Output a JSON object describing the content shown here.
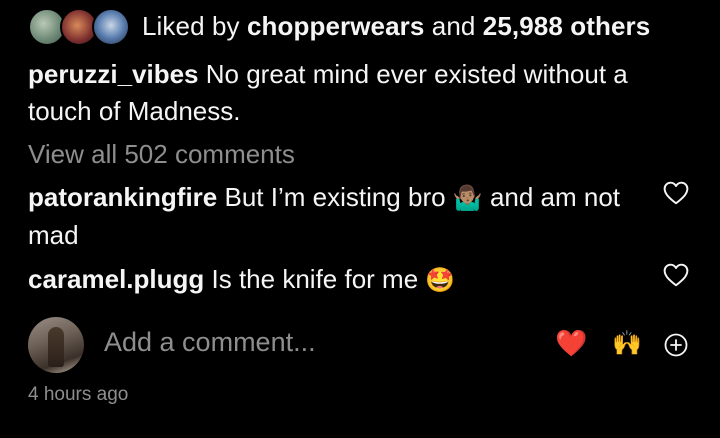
{
  "likes": {
    "prefix": "Liked by ",
    "user": "chopperwears",
    "middle": " and ",
    "count": "25,988 others"
  },
  "caption": {
    "username": "peruzzi_vibes",
    "text": "No great mind ever existed without a touch of Madness."
  },
  "view_all_comments": "View all 502 comments",
  "comments": [
    {
      "username": "patorankingfire",
      "text_before": "But I’m existing bro",
      "emoji": "🤷🏽‍♂️",
      "text_after": "and am not mad"
    },
    {
      "username": "caramel.plugg",
      "text_before": "Is the knife for me",
      "emoji": "🤩"
    }
  ],
  "add_comment": {
    "placeholder": "Add a comment...",
    "quick_reactions": [
      "❤️",
      "🙌"
    ]
  },
  "timestamp": "4 hours ago",
  "icons": {
    "like_comment": "heart-outline-icon",
    "add_more": "plus-circle-icon"
  }
}
